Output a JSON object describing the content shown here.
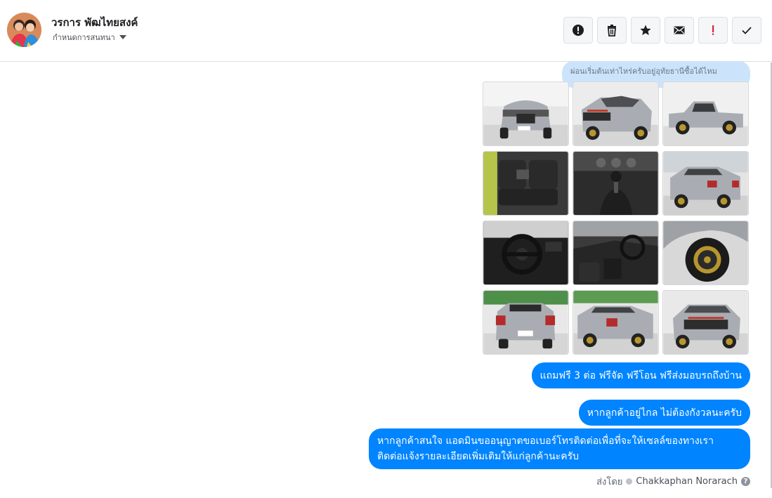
{
  "header": {
    "user_name": "วรการ พัฒไทยสงค์",
    "assign_label": "กำหนดการสนทนา",
    "actions": [
      {
        "name": "report-spam-button",
        "icon": "alert-circle-icon"
      },
      {
        "name": "delete-button",
        "icon": "trash-icon"
      },
      {
        "name": "star-button",
        "icon": "star-icon"
      },
      {
        "name": "mark-unread-button",
        "icon": "envelope-icon"
      },
      {
        "name": "follow-up-button",
        "icon": "exclamation-icon",
        "color": "#e41e3f"
      },
      {
        "name": "mark-done-button",
        "icon": "check-icon"
      }
    ]
  },
  "conversation": {
    "previous_message": "ผ่อนเริ่มต้นเท่าไหร่ครับอยู่อุทัยธานีซื้อได้ไหม",
    "photos": [
      {
        "subject": "truck-front"
      },
      {
        "subject": "truck-front-three-quarter"
      },
      {
        "subject": "truck-side"
      },
      {
        "subject": "rear-seats"
      },
      {
        "subject": "gear-shifter"
      },
      {
        "subject": "truck-rear-three-quarter"
      },
      {
        "subject": "steering-wheel"
      },
      {
        "subject": "cabin-interior"
      },
      {
        "subject": "wheel-tire"
      },
      {
        "subject": "truck-rear"
      },
      {
        "subject": "truck-rear-three-quarter-2"
      },
      {
        "subject": "truck-front-2"
      }
    ],
    "messages": [
      "แถมฟรี 3 ต่อ ฟรีจัด ฟรีโอน  ฟรีส่งมอบรถถึงบ้าน",
      "หากลูกค้าอยู่ไกล ไม่ต้องกังวลนะครับ",
      "หากลูกค้าสนใจ แอดมินขออนุญาตขอเบอร์โทรติดต่อเพื่อที่จะให้เซลล์ของทางเรา",
      "ติดต่อแจ้งรายละเอียดเพิ่มเติมให้แก่ลูกค้านะครับ"
    ],
    "sent_by_label": "ส่งโดย",
    "sent_by_agent": "Chakkaphan Norarach",
    "help_glyph": "?"
  },
  "colors": {
    "bubble_blue": "#0084ff",
    "prev_bubble": "#cce4fb",
    "truck_silver": "#a9adb3"
  }
}
